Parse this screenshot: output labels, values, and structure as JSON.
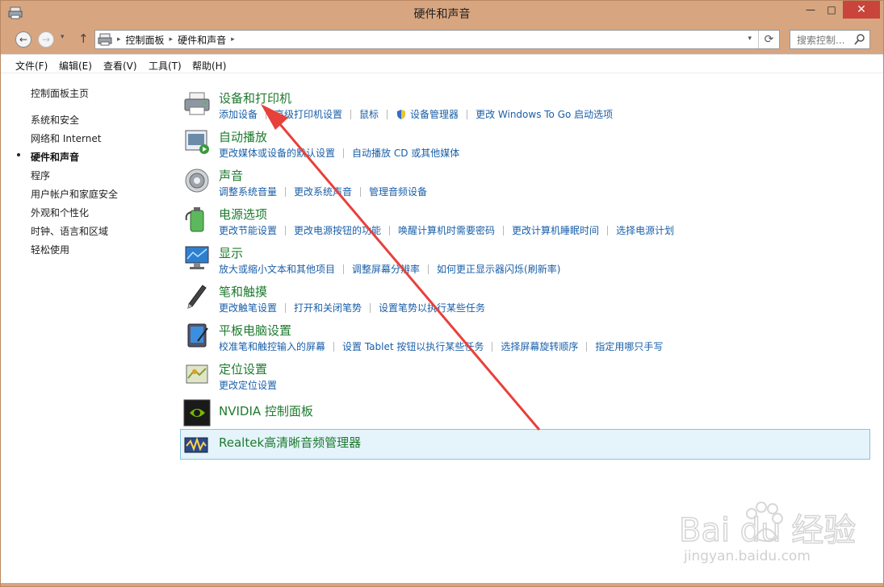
{
  "window": {
    "title": "硬件和声音",
    "minimize_glyph": "—",
    "maximize_glyph": "□",
    "close_glyph": "✕"
  },
  "nav": {
    "back_glyph": "←",
    "forward_glyph": "→",
    "up_glyph": "↑",
    "dropdown_glyph": "▾",
    "breadcrumb": [
      "控制面板",
      "硬件和声音"
    ],
    "breadcrumb_sep": "▸",
    "refresh_glyph": "⟳",
    "search_placeholder": "搜索控制..."
  },
  "menu": [
    "文件(F)",
    "编辑(E)",
    "查看(V)",
    "工具(T)",
    "帮助(H)"
  ],
  "sidebar": {
    "items": [
      "控制面板主页",
      "系统和安全",
      "网络和 Internet",
      "硬件和声音",
      "程序",
      "用户帐户和家庭安全",
      "外观和个性化",
      "时钟、语言和区域",
      "轻松使用"
    ],
    "current_index": 3
  },
  "categories": [
    {
      "icon": "printer-icon",
      "title": "设备和打印机",
      "links": [
        "添加设备",
        "高级打印机设置",
        "鼠标",
        "设备管理器",
        "更改 Windows To Go 启动选项"
      ],
      "shield_link_index": 3
    },
    {
      "icon": "autoplay-icon",
      "title": "自动播放",
      "links": [
        "更改媒体或设备的默认设置",
        "自动播放 CD 或其他媒体"
      ]
    },
    {
      "icon": "speaker-icon",
      "title": "声音",
      "links": [
        "调整系统音量",
        "更改系统声音",
        "管理音频设备"
      ]
    },
    {
      "icon": "battery-icon",
      "title": "电源选项",
      "links": [
        "更改节能设置",
        "更改电源按钮的功能",
        "唤醒计算机时需要密码",
        "更改计算机睡眠时间",
        "选择电源计划"
      ]
    },
    {
      "icon": "monitor-icon",
      "title": "显示",
      "links": [
        "放大或缩小文本和其他项目",
        "调整屏幕分辨率",
        "如何更正显示器闪烁(刷新率)"
      ]
    },
    {
      "icon": "pen-icon",
      "title": "笔和触摸",
      "links": [
        "更改触笔设置",
        "打开和关闭笔势",
        "设置笔势以执行某些任务"
      ]
    },
    {
      "icon": "tablet-icon",
      "title": "平板电脑设置",
      "links": [
        "校准笔和触控输入的屏幕",
        "设置 Tablet 按钮以执行某些任务",
        "选择屏幕旋转顺序",
        "指定用哪只手写"
      ]
    },
    {
      "icon": "location-icon",
      "title": "定位设置",
      "links": [
        "更改定位设置"
      ]
    },
    {
      "icon": "nvidia-icon",
      "title": "NVIDIA 控制面板",
      "links": []
    },
    {
      "icon": "realtek-icon",
      "title": "Realtek高清晰音频管理器",
      "links": []
    }
  ],
  "colors": {
    "title_bar": "#d7a57f",
    "category_title": "#1e7a2f",
    "link": "#1a5fa8",
    "close_button": "#c9443a",
    "annotation_arrow": "#e8403a",
    "hover_row": "#e5f3fb"
  },
  "watermark": {
    "brand": "Bai du 经验",
    "url": "jingyan.baidu.com"
  }
}
